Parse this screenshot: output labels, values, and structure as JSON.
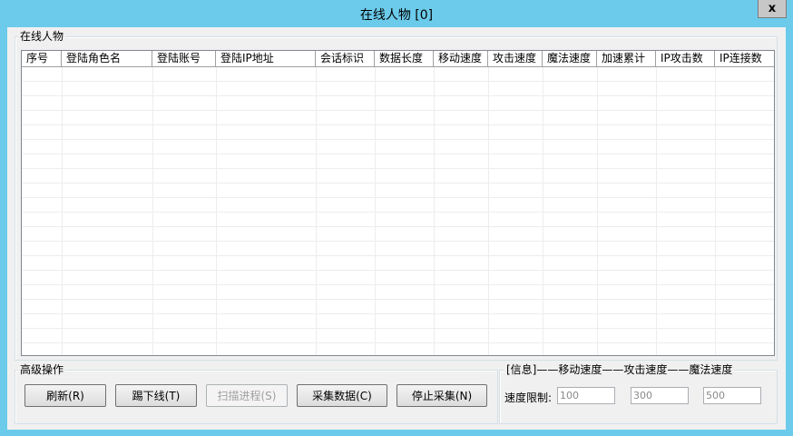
{
  "window": {
    "title": "在线人物 [0]",
    "close_label": "x"
  },
  "online_group": {
    "title": "在线人物",
    "columns": [
      "序号",
      "登陆角色名",
      "登陆账号",
      "登陆IP地址",
      "会话标识",
      "数据长度",
      "移动速度",
      "攻击速度",
      "魔法速度",
      "加速累计",
      "IP攻击数",
      "IP连接数"
    ],
    "rows": []
  },
  "advanced_group": {
    "title": "高级操作",
    "buttons": {
      "refresh": "刷新(R)",
      "kick": "踢下线(T)",
      "scan": "扫描进程(S)",
      "collect": "采集数据(C)",
      "stop": "停止采集(N)"
    }
  },
  "info_group": {
    "title": "[信息]——移动速度——攻击速度——魔法速度",
    "speed_limit_label": "速度限制:",
    "move_speed": "100",
    "attack_speed": "300",
    "magic_speed": "500"
  }
}
